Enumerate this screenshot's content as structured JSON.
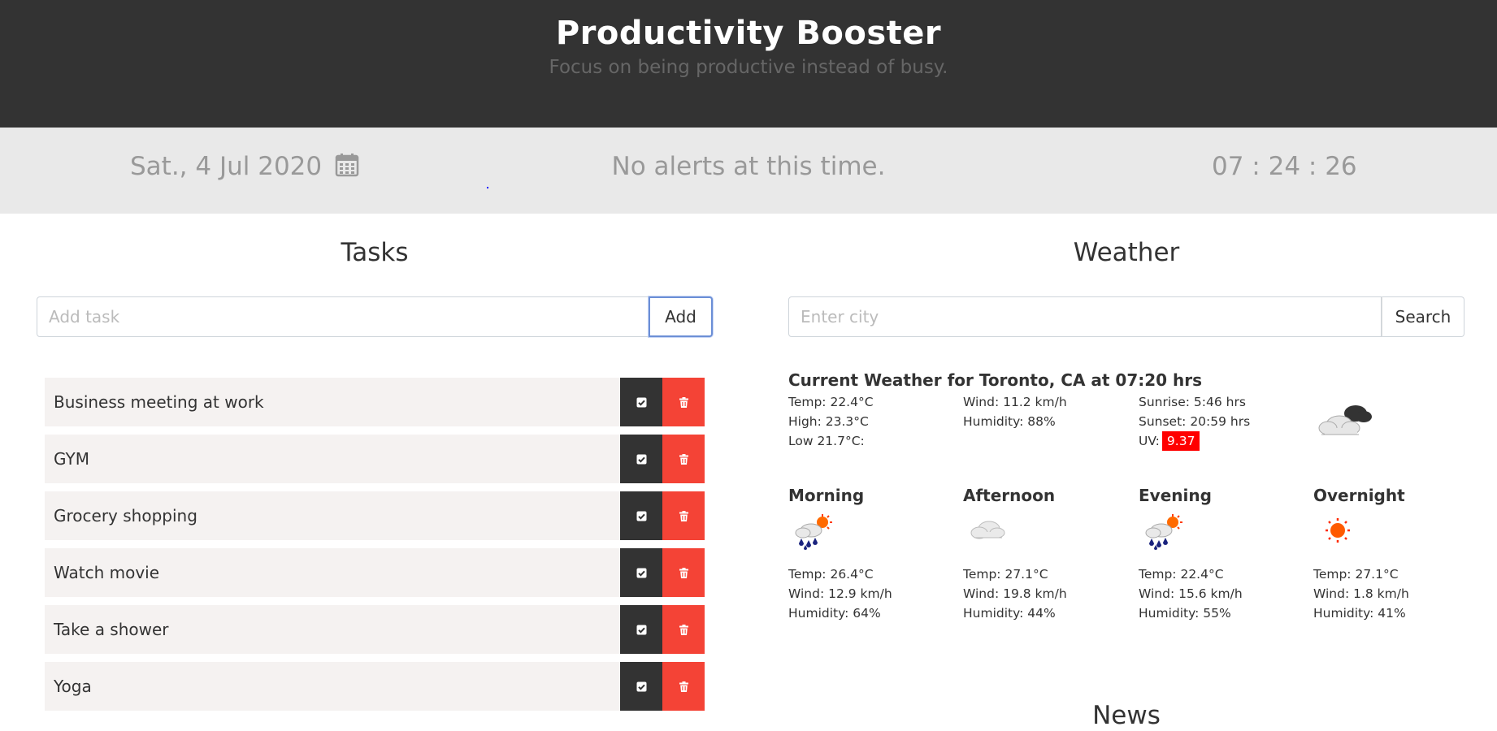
{
  "app": {
    "title": "Productivity Booster",
    "subtitle": "Focus on being productive instead of busy."
  },
  "infobar": {
    "date": "Sat., 4 Jul 2020",
    "alerts": "No alerts at this time.",
    "clock": "07 : 24 : 26"
  },
  "tasks": {
    "heading": "Tasks",
    "placeholder": "Add task",
    "add_label": "Add",
    "items": [
      {
        "label": "Business meeting at work"
      },
      {
        "label": "GYM"
      },
      {
        "label": "Grocery shopping"
      },
      {
        "label": "Watch movie"
      },
      {
        "label": "Take a shower"
      },
      {
        "label": "Yoga"
      }
    ]
  },
  "weather": {
    "heading": "Weather",
    "placeholder": "Enter city",
    "search_label": "Search",
    "current_title": "Current Weather for Toronto, CA at 07:20 hrs",
    "current": {
      "temp": "Temp:  22.4°C",
      "high": "High:  23.3°C",
      "low": "Low  21.7°C:",
      "wind": "Wind:  11.2 km/h",
      "humidity": "Humidity:  88%",
      "sunrise": "Sunrise:  5:46 hrs",
      "sunset": "Sunset:  20:59 hrs",
      "uv_label": "UV:",
      "uv_value": "9.37",
      "icon": "cloudy-night-icon"
    },
    "periods": [
      {
        "name": "Morning",
        "icon": "rain-sun-icon",
        "temp": "Temp:   26.4°C",
        "wind": "Wind:   12.9 km/h",
        "humidity": "Humidity:   64%"
      },
      {
        "name": "Afternoon",
        "icon": "cloud-icon",
        "temp": "Temp:   27.1°C",
        "wind": "Wind:   19.8 km/h",
        "humidity": "Humidity:   44%"
      },
      {
        "name": "Evening",
        "icon": "rain-sun-icon",
        "temp": "Temp:   22.4°C",
        "wind": "Wind:   15.6 km/h",
        "humidity": "Humidity:   55%"
      },
      {
        "name": "Overnight",
        "icon": "sun-icon",
        "temp": "Temp:   27.1°C",
        "wind": "Wind:   1.8 km/h",
        "humidity": "Humidity:   41%"
      }
    ]
  },
  "news": {
    "heading": "News"
  },
  "colors": {
    "header_bg": "#333333",
    "infobar_bg": "#e9e9e9",
    "done_button": "#333333",
    "delete_button": "#f44336",
    "uv_badge": "#ff0000"
  }
}
